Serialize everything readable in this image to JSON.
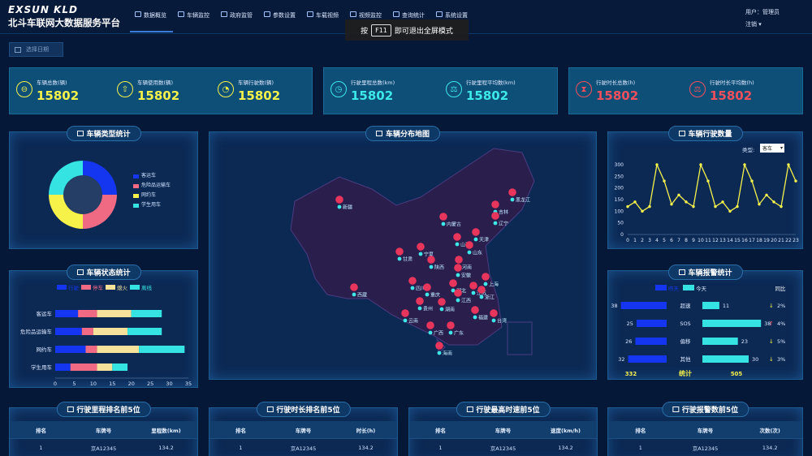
{
  "header": {
    "logo": "EXSUN KLD",
    "title": "北斗车联网大数据服务平台",
    "nav": [
      "数据概览",
      "车辆监控",
      "政府监管",
      "参数设置",
      "车载视频",
      "视频监控",
      "查询统计",
      "系统设置"
    ],
    "user_label": "用户：管理员",
    "logout": "注销"
  },
  "toast": {
    "prefix": "按",
    "key": "F11",
    "suffix": "即可退出全屏模式"
  },
  "date_button": "选择日期",
  "kpis": [
    {
      "label": "车辆总数(辆)",
      "value": "15802",
      "icon": "car-icon",
      "color": "#f6f24a"
    },
    {
      "label": "车辆使用数(辆)",
      "value": "15802",
      "icon": "upload-icon",
      "color": "#f6f24a"
    },
    {
      "label": "车辆行驶数(辆)",
      "value": "15802",
      "icon": "chart-icon",
      "color": "#f6f24a"
    },
    {
      "label": "行驶里程总数(km)",
      "value": "15802",
      "icon": "gauge-icon",
      "color": "#3de8e8"
    },
    {
      "label": "行驶里程平均数(km)",
      "value": "15802",
      "icon": "balance-icon",
      "color": "#3de8e8"
    },
    {
      "label": "行驶时长总数(h)",
      "value": "15802",
      "icon": "hourglass-icon",
      "color": "#f04f5c"
    },
    {
      "label": "行驶时长平均数(h)",
      "value": "15802",
      "icon": "balance-icon",
      "color": "#f04f5c"
    }
  ],
  "panels": {
    "type_stats": "车辆类型统计",
    "map": "车辆分布地图",
    "drive_count": "车辆行驶数量",
    "status_stats": "车辆状态统计",
    "alarm_stats": "车辆报警统计",
    "rank_mileage": "行驶里程排名前5位",
    "rank_duration": "行驶时长排名前5位",
    "rank_speed": "行驶最高时速前5位",
    "rank_alarm": "行驶报警数前5位"
  },
  "type_filter": {
    "label": "类型:",
    "value": "客车"
  },
  "map_labels": [
    "新疆",
    "西藏",
    "黑龙江",
    "吉林",
    "辽宁",
    "内蒙古",
    "天津",
    "宁夏",
    "山西",
    "山东",
    "甘肃",
    "陕西",
    "河南",
    "四川",
    "重庆",
    "湖北",
    "安徽",
    "江苏",
    "上海",
    "浙江",
    "贵州",
    "湖南",
    "江西",
    "云南",
    "广西",
    "广东",
    "福建",
    "台湾",
    "海南"
  ],
  "tables": {
    "mileage": {
      "headers": [
        "排名",
        "车牌号",
        "里程数(km)"
      ],
      "rows": [
        [
          "1",
          "京A12345",
          "134.2"
        ]
      ]
    },
    "duration": {
      "headers": [
        "排名",
        "车牌号",
        "时长(h)"
      ],
      "rows": [
        [
          "1",
          "京A12345",
          "134.2"
        ]
      ]
    },
    "speed": {
      "headers": [
        "排名",
        "车牌号",
        "速度(km/h)"
      ],
      "rows": [
        [
          "1",
          "京A12345",
          "134.2"
        ]
      ]
    },
    "alarm": {
      "headers": [
        "排名",
        "车牌号",
        "次数(次)"
      ],
      "rows": [
        [
          "1",
          "京A12345",
          "134.2"
        ]
      ]
    }
  },
  "chart_data": [
    {
      "type": "pie",
      "title": "车辆类型统计",
      "categories": [
        "客运车",
        "危险品运输车",
        "网约车",
        "学生用车"
      ],
      "values": [
        25,
        25,
        25,
        25
      ],
      "colors": [
        "#1436f0",
        "#f06a84",
        "#f6f24a",
        "#35e3e3"
      ]
    },
    {
      "type": "line",
      "title": "车辆行驶数量",
      "x": [
        0,
        1,
        2,
        3,
        4,
        5,
        6,
        7,
        8,
        9,
        10,
        11,
        12,
        13,
        14,
        15,
        16,
        17,
        18,
        19,
        20,
        21,
        22,
        23
      ],
      "values": [
        120,
        140,
        100,
        120,
        300,
        230,
        130,
        170,
        140,
        120,
        300,
        230,
        120,
        140,
        100,
        120,
        300,
        230,
        130,
        170,
        140,
        120,
        300,
        230
      ],
      "ylim": [
        0,
        300
      ],
      "yticks": [
        0,
        50,
        100,
        150,
        200,
        250,
        300
      ],
      "color": "#f6f24a"
    },
    {
      "type": "bar",
      "title": "车辆状态统计",
      "stacked": true,
      "orientation": "horizontal",
      "categories": [
        "客运车",
        "危险品运输车",
        "网约车",
        "学生用车"
      ],
      "series": [
        {
          "name": "行驶",
          "values": [
            6,
            7,
            8,
            4
          ],
          "color": "#1436f0"
        },
        {
          "name": "停车",
          "values": [
            5,
            3,
            3,
            7
          ],
          "color": "#f06a84"
        },
        {
          "name": "熄火",
          "values": [
            9,
            9,
            11,
            4
          ],
          "color": "#f6e19a"
        },
        {
          "name": "离线",
          "values": [
            8,
            9,
            12,
            4
          ],
          "color": "#35e3e3"
        }
      ],
      "xlim": [
        0,
        35
      ],
      "xticks": [
        0,
        5,
        10,
        15,
        20,
        25,
        30,
        35
      ]
    },
    {
      "type": "bar",
      "title": "车辆报警统计",
      "orientation": "horizontal",
      "categories": [
        "超速",
        "SOS",
        "偏移",
        "其他"
      ],
      "series": [
        {
          "name": "昨天",
          "values": [
            38,
            25,
            26,
            32
          ],
          "color": "#1436f0"
        },
        {
          "name": "今天",
          "values": [
            11,
            38,
            23,
            30
          ],
          "color": "#35e3e3"
        }
      ],
      "ratio_label": "同比",
      "ratios": [
        {
          "text": "2%",
          "dir": "down"
        },
        {
          "text": "4%",
          "dir": "up"
        },
        {
          "text": "5%",
          "dir": "down"
        },
        {
          "text": "3%",
          "dir": "down"
        }
      ],
      "totals": {
        "yesterday": "332",
        "label": "统计",
        "today": "505"
      }
    }
  ]
}
